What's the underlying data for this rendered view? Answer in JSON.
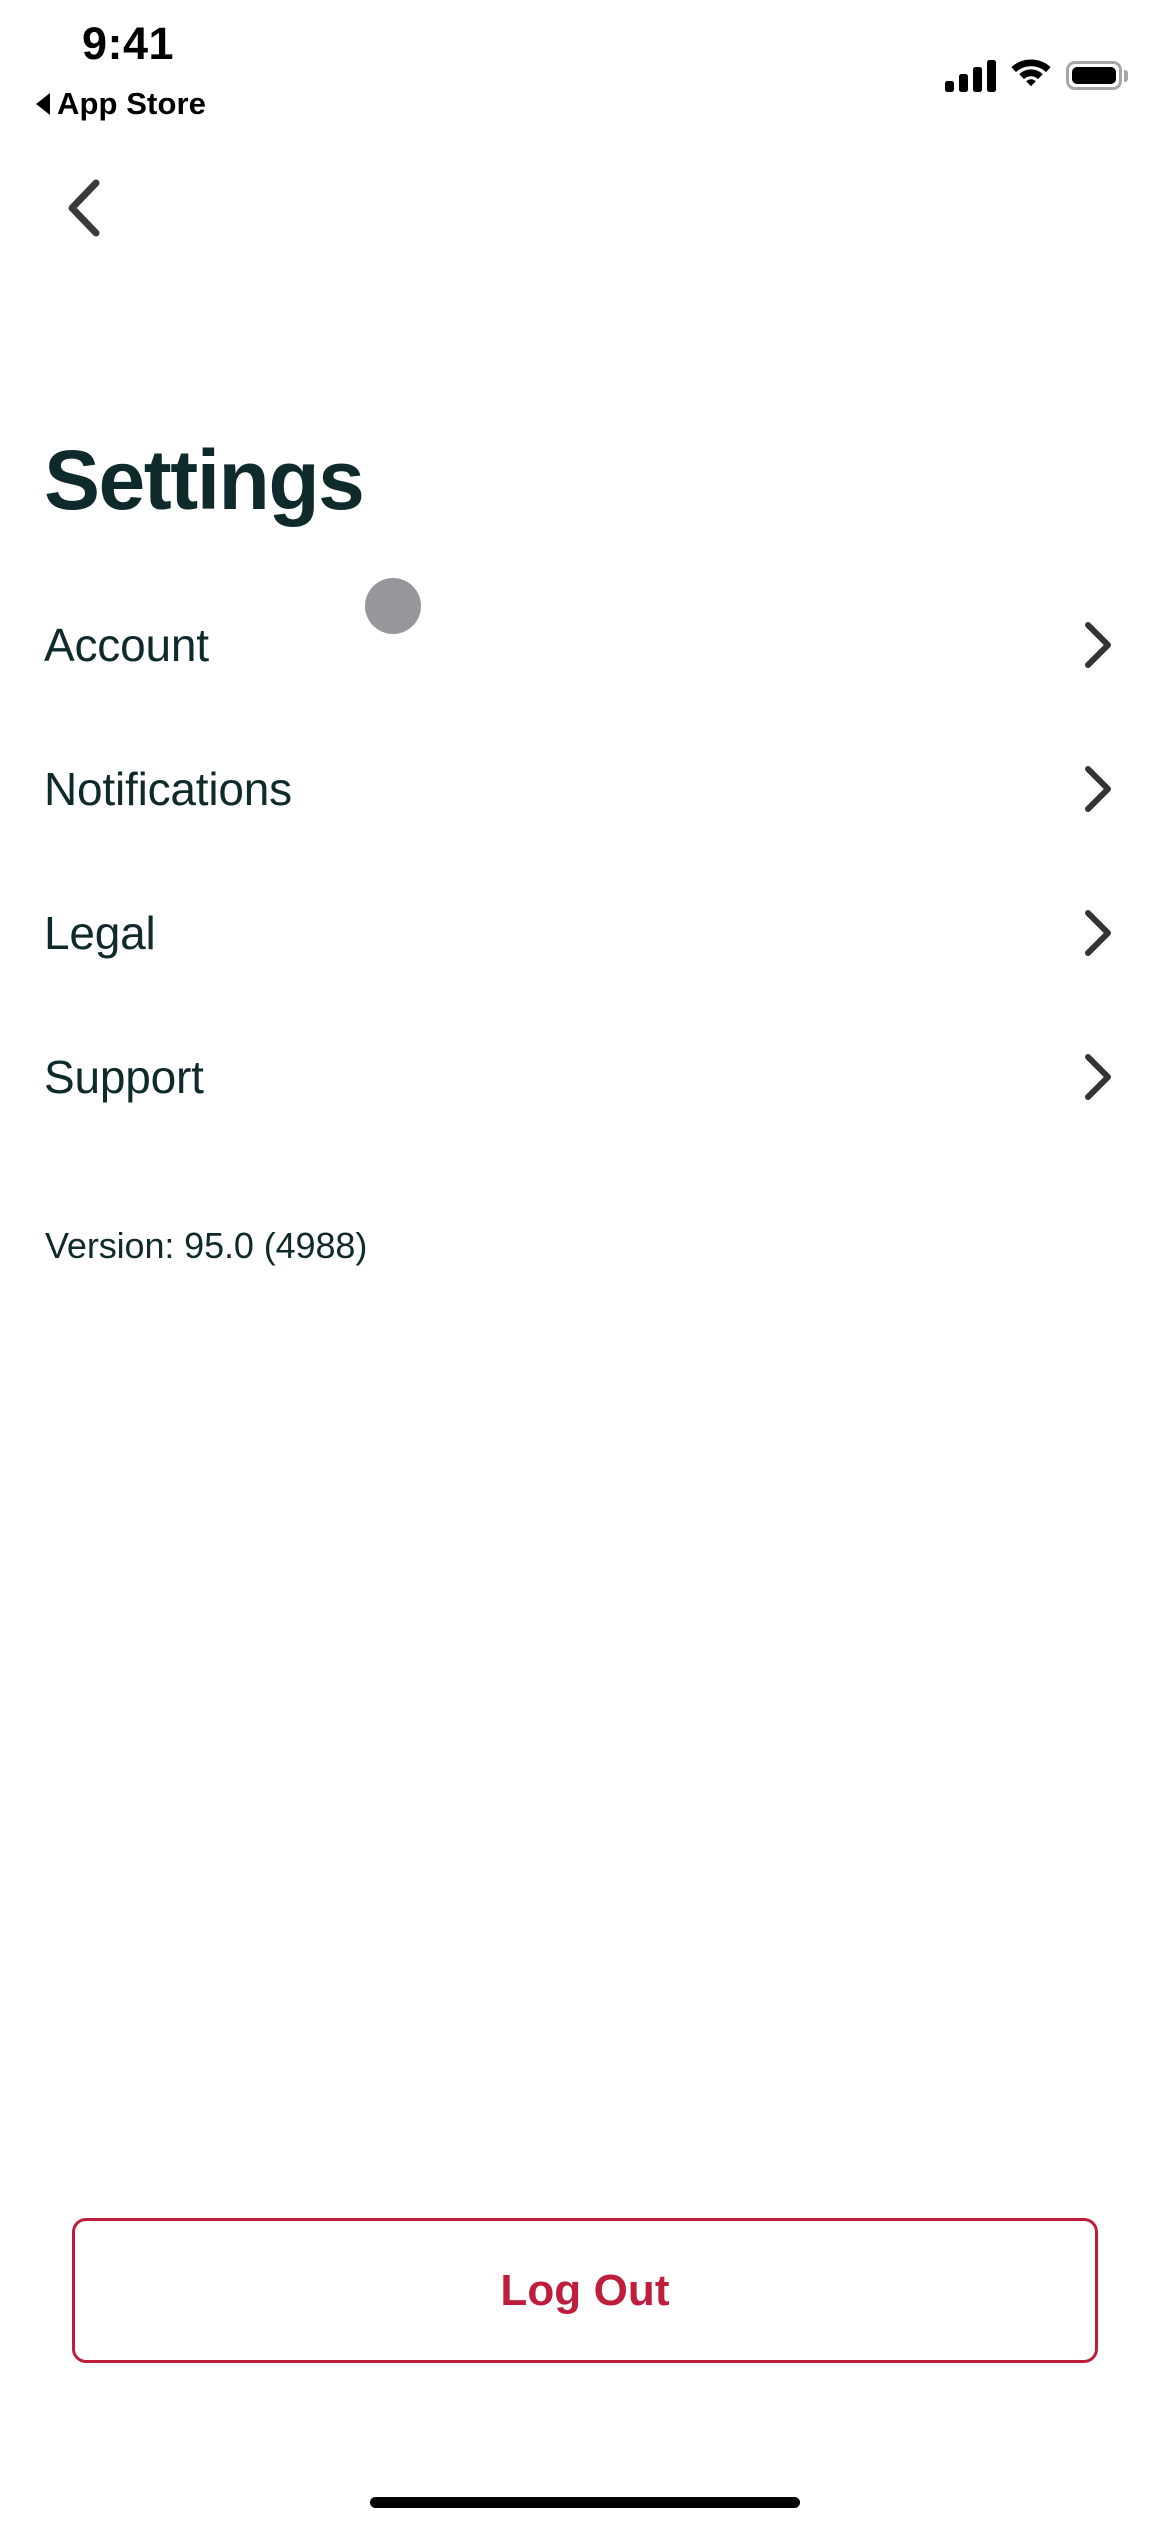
{
  "status_bar": {
    "time": "9:41",
    "back_app_label": "App Store",
    "icons": {
      "back_triangle": "triangle-left-icon",
      "signal": "cellular-signal-icon",
      "wifi": "wifi-icon",
      "battery": "battery-full-icon"
    }
  },
  "nav": {
    "back_icon": "chevron-left-icon"
  },
  "header": {
    "title": "Settings"
  },
  "list": {
    "rows": [
      {
        "label": "Account",
        "chevron": "chevron-right-icon",
        "has_dot": true
      },
      {
        "label": "Notifications",
        "chevron": "chevron-right-icon",
        "has_dot": false
      },
      {
        "label": "Legal",
        "chevron": "chevron-right-icon",
        "has_dot": false
      },
      {
        "label": "Support",
        "chevron": "chevron-right-icon",
        "has_dot": false
      }
    ]
  },
  "footer": {
    "version": "Version: 95.0 (4988)"
  },
  "logout": {
    "label": "Log Out"
  },
  "colors": {
    "title": "#0F2A2B",
    "row_label": "#10292A",
    "chevron": "#333333",
    "danger": "#BE1E3C",
    "dot": "#97979B",
    "background": "#FFFFFF"
  }
}
